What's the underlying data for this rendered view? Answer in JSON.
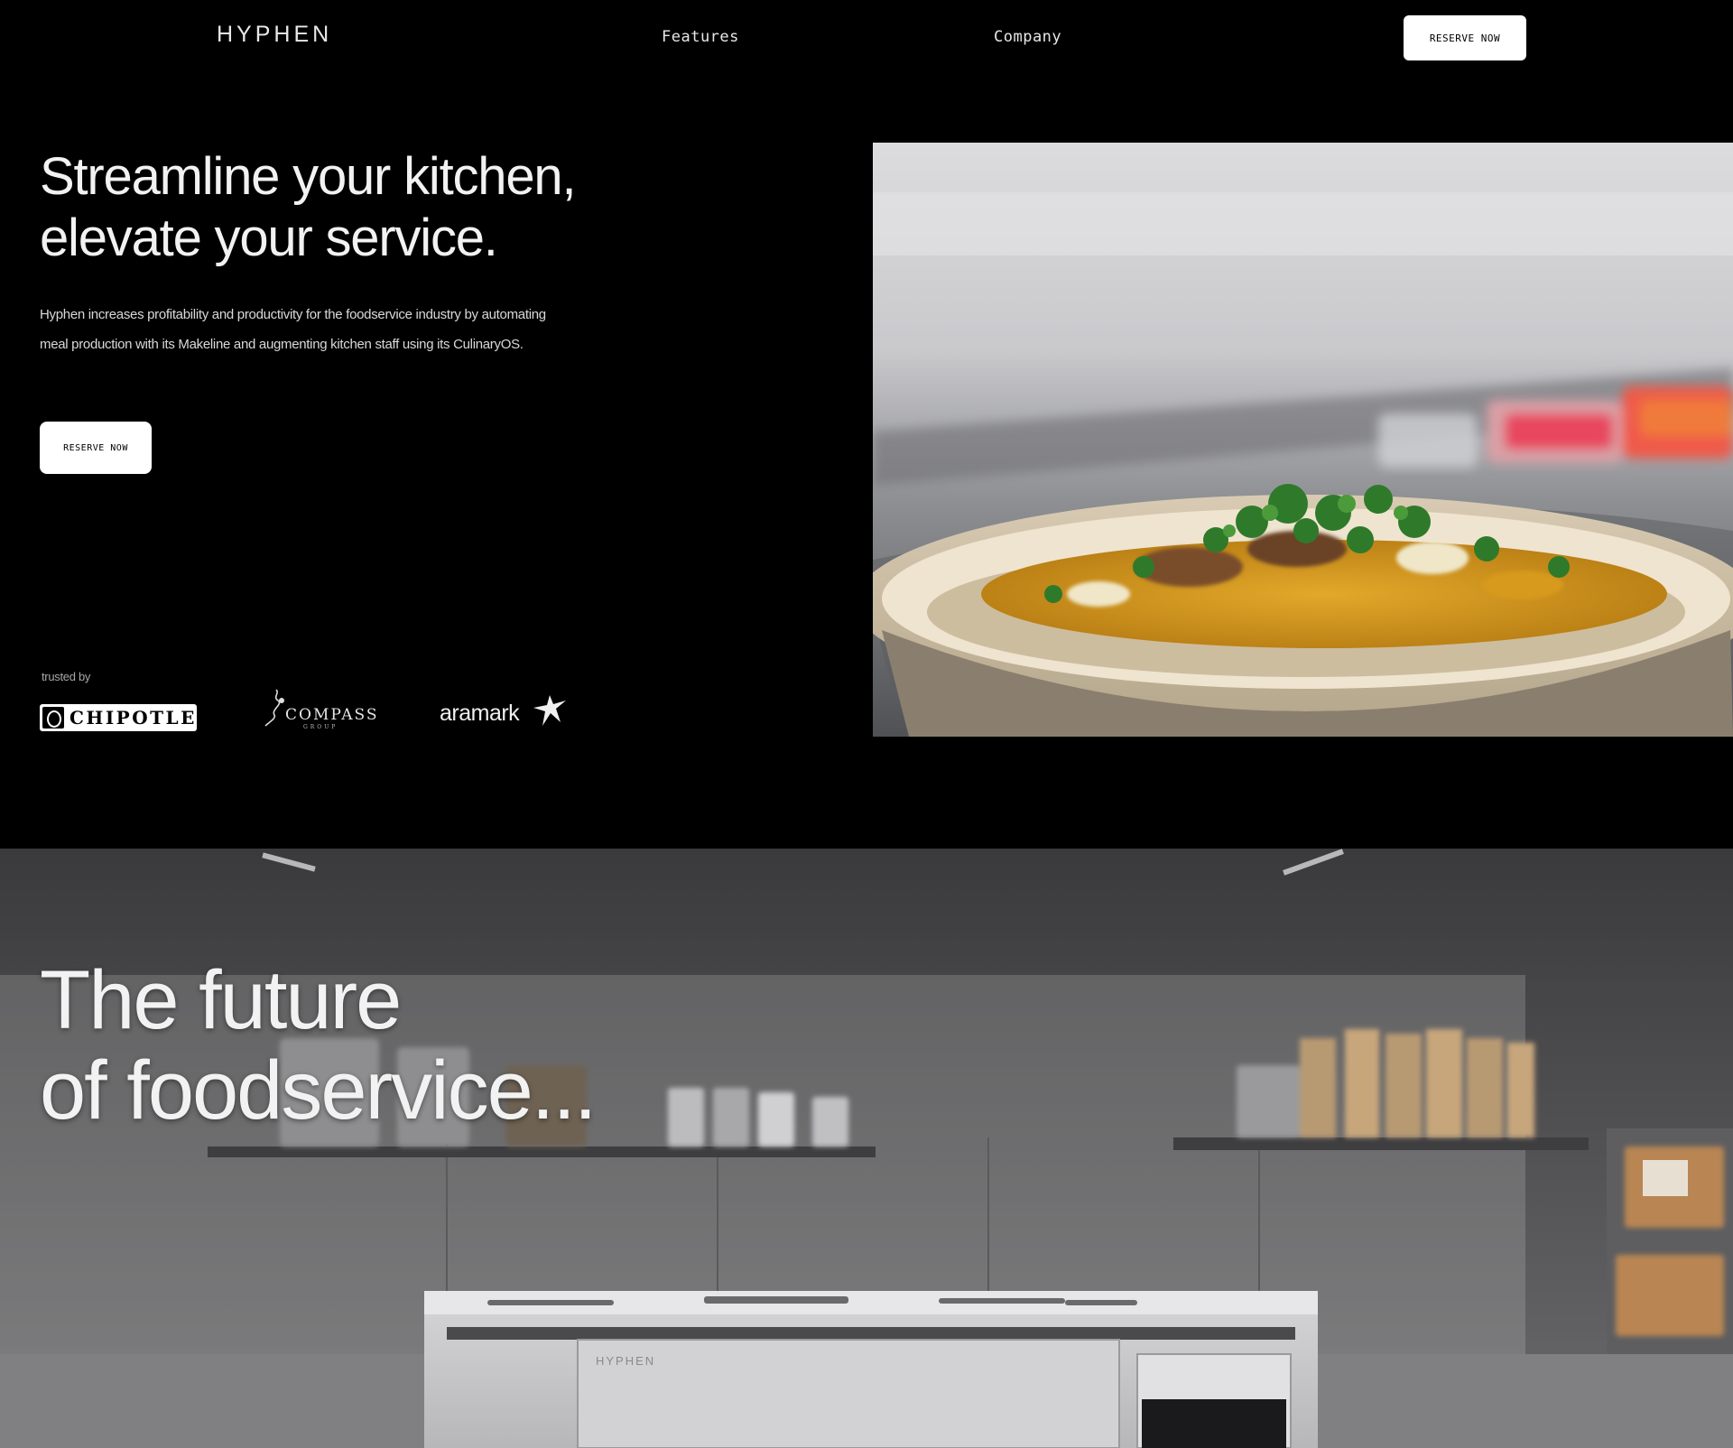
{
  "nav": {
    "logo": "HYPHEN",
    "links": [
      "Features",
      "Company"
    ],
    "cta_label": "RESERVE NOW"
  },
  "hero": {
    "title_line1": "Streamline your kitchen,",
    "title_line2": "elevate your service.",
    "description": "Hyphen increases profitability and productivity for the foodservice industry by automating meal production with its Makeline and augmenting kitchen staff using its CulinaryOS.",
    "cta_label": "RESERVE NOW",
    "image_icon": "food-bowl-photo"
  },
  "trusted": {
    "label": "trusted by",
    "brands": [
      "CHIPOTLE",
      "COMPASS",
      "GROUP",
      "aramark"
    ]
  },
  "future": {
    "title_line1": "The future",
    "title_line2": "of foodservice...",
    "image_icon": "kitchen-photo",
    "machine_label": "HYPHEN"
  },
  "colors": {
    "background": "#000000",
    "text": "#f2f2f2",
    "button": "#ffffff"
  }
}
